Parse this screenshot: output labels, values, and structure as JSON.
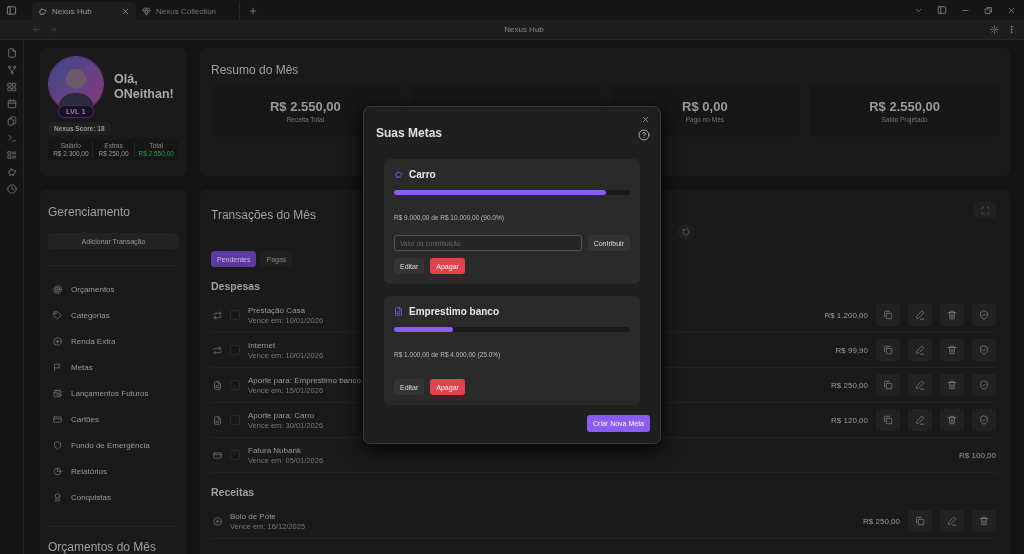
{
  "tabs": [
    {
      "label": "Nexus Hub",
      "selected": true
    },
    {
      "label": "Nexus Collection",
      "selected": false
    }
  ],
  "window": {
    "title": "Nexus Hub"
  },
  "profile": {
    "greeting": "Olá, ONeithan!",
    "level_badge": "LVL 1",
    "score": "Nexus Score: 18",
    "stats": [
      {
        "label": "Salário",
        "value": "R$ 2.300,00",
        "kind": "plain"
      },
      {
        "label": "Extras",
        "value": "R$ 250,00",
        "kind": "plain"
      },
      {
        "label": "Total",
        "value": "R$ 2.550,00",
        "kind": "positive"
      }
    ]
  },
  "summary": {
    "title": "Resumo do Mês",
    "cards": [
      {
        "covered": false,
        "value": "R$ 2.550,00",
        "label": "Receita Total"
      },
      {
        "covered": true
      },
      {
        "covered": false,
        "value": "R$ 0,00",
        "label": "Pago no Mês"
      },
      {
        "covered": false,
        "value": "R$ 2.550,00",
        "label": "Saldo Projetado"
      }
    ]
  },
  "management": {
    "title": "Gerenciamento",
    "add_button": "Adicionar Transação",
    "items": [
      "Orçamentos",
      "Categorias",
      "Renda Extra",
      "Metas",
      "Lançamentos Futuros",
      "Cartões",
      "Fundo de Emergência",
      "Relatórios",
      "Conquistas"
    ],
    "budgets_title": "Orçamentos do Mês"
  },
  "transactions": {
    "title": "Transações do Mês",
    "filters": [
      {
        "label": "Pendentes",
        "selected": true
      },
      {
        "label": "Pagas",
        "selected": false
      }
    ],
    "sections": [
      {
        "title": "Despesas",
        "rows": [
          {
            "kind": "recurring",
            "name": "Prestação Casa",
            "due": "Vence em: 10/01/2026",
            "amount": "R$ 1.200,00",
            "checked": false
          },
          {
            "kind": "recurring",
            "name": "Internet",
            "due": "Vence em: 10/01/2026",
            "amount": "R$ 99,90",
            "checked": false
          },
          {
            "kind": "goal",
            "name": "Aporte para: Emprestimo banco",
            "due": "Vence em: 15/01/2026",
            "amount": "R$ 250,00",
            "checked": false
          },
          {
            "kind": "goal",
            "name": "Aporte para: Carro",
            "due": "Vence em: 30/01/2026",
            "amount": "R$ 120,00",
            "checked": false
          },
          {
            "kind": "card",
            "name": "Fatura Nubank",
            "due": "Vence em: 05/01/2026",
            "amount": "R$ 100,00",
            "checked": false
          }
        ]
      },
      {
        "title": "Receitas",
        "rows": [
          {
            "kind": "income",
            "name": "Bolo de Pote",
            "due": "Vence em: 16/12/2025",
            "amount": "R$ 250,00"
          }
        ]
      }
    ]
  },
  "modal": {
    "title": "Suas Metas",
    "goals": [
      {
        "kind": "savings",
        "name": "Carro",
        "level": 0.9,
        "progress": "R$ 9.000,00 de R$ 10.000,00 (90.0%)",
        "contribution": {
          "placeholder": "Valor da contribuição",
          "button": "Contribuir"
        },
        "edit": "Editar",
        "delete": "Apagar"
      },
      {
        "kind": "debt",
        "name": "Emprestimo banco",
        "level": 0.25,
        "progress": "R$ 1.000,00 de R$ 4.000,00 (25.0%)",
        "edit": "Editar",
        "delete": "Apagar"
      }
    ],
    "create_button": "Criar Nova Meta"
  }
}
